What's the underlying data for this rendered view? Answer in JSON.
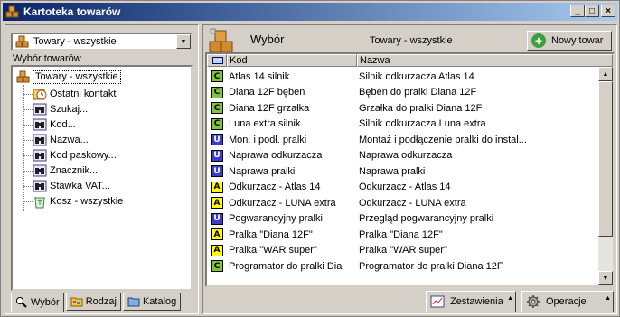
{
  "window": {
    "title": "Kartoteka towarów",
    "btn_min": "_",
    "btn_max": "□",
    "btn_close": "×"
  },
  "left": {
    "combo_value": "Towary - wszystkie",
    "tree_label": "Wybór towarów",
    "tree_root": "Towary - wszystkie",
    "tree_items": [
      {
        "label": "Ostatni kontakt",
        "icon": "clock-icon"
      },
      {
        "label": "Szukaj...",
        "icon": "binoculars-icon"
      },
      {
        "label": "Kod...",
        "icon": "binoculars-icon"
      },
      {
        "label": "Nazwa...",
        "icon": "binoculars-icon"
      },
      {
        "label": "Kod paskowy...",
        "icon": "binoculars-icon"
      },
      {
        "label": "Znacznik...",
        "icon": "binoculars-icon"
      },
      {
        "label": "Stawka VAT...",
        "icon": "binoculars-icon"
      },
      {
        "label": "Kosz - wszystkie",
        "icon": "recycle-bin-icon"
      }
    ],
    "tabs": [
      {
        "label": "Wybór",
        "icon": "magnifier-icon"
      },
      {
        "label": "Rodzaj",
        "icon": "folder-icon"
      },
      {
        "label": "Katalog",
        "icon": "folder-icon"
      }
    ]
  },
  "right": {
    "header_title": "Wybór",
    "header_filter": "Towary - wszystkie",
    "new_button": "Nowy towar",
    "columns": {
      "kod": "Kod",
      "nazwa": "Nazwa"
    },
    "rows": [
      {
        "type": "C",
        "kod": "Atlas 14 silnik",
        "nazwa": "Silnik odkurzacza Atlas 14"
      },
      {
        "type": "C",
        "kod": "Diana 12F bęben",
        "nazwa": "Bęben do pralki Diana 12F"
      },
      {
        "type": "C",
        "kod": "Diana 12F grzałka",
        "nazwa": "Grzałka do pralki Diana 12F"
      },
      {
        "type": "C",
        "kod": "Luna extra silnik",
        "nazwa": "Silnik odkurzacza Luna extra"
      },
      {
        "type": "U",
        "kod": "Mon. i podł. pralki",
        "nazwa": "Montaż i podłączenie pralki do instal..."
      },
      {
        "type": "U",
        "kod": "Naprawa odkurzacza",
        "nazwa": "Naprawa odkurzacza"
      },
      {
        "type": "U",
        "kod": "Naprawa pralki",
        "nazwa": "Naprawa pralki"
      },
      {
        "type": "A",
        "kod": "Odkurzacz - Atlas 14",
        "nazwa": "Odkurzacz - Atlas 14"
      },
      {
        "type": "A",
        "kod": "Odkurzacz - LUNA extra",
        "nazwa": "Odkurzacz - LUNA extra"
      },
      {
        "type": "U",
        "kod": "Pogwarancyjny pralki",
        "nazwa": "Przegląd pogwarancyjny pralki"
      },
      {
        "type": "A",
        "kod": "Pralka \"Diana 12F\"",
        "nazwa": "Pralka \"Diana 12F\""
      },
      {
        "type": "A",
        "kod": "Pralka \"WAR super\"",
        "nazwa": "Pralka \"WAR super\""
      },
      {
        "type": "C",
        "kod": "Programator do pralki Dia",
        "nazwa": "Programator do pralki Diana 12F"
      }
    ],
    "footer_zestawienia": "Zestawienia",
    "footer_operacje": "Operacje"
  },
  "colors": {
    "title_gradient_start": "#0a246a",
    "title_gradient_end": "#a6caf0",
    "badge_C": "#7fc43a",
    "badge_U": "#3c3cd0",
    "badge_A": "#ffff00",
    "window_bg": "#d4d0c8"
  }
}
